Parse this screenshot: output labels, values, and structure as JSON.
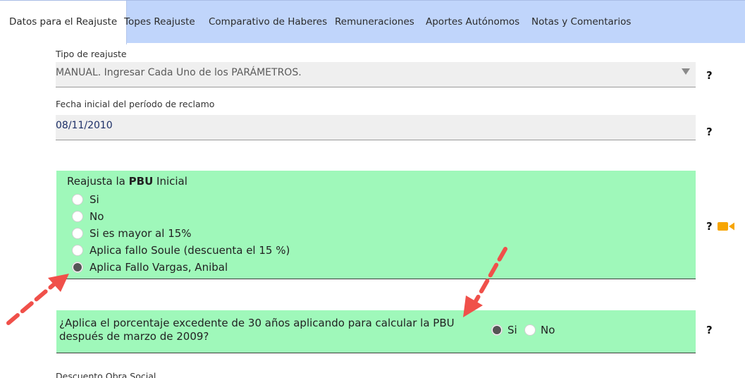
{
  "tabs": [
    {
      "label": "Datos para el Reajuste",
      "active": true
    },
    {
      "label": "Topes Reajuste",
      "active": false
    },
    {
      "label": "Comparativo de Haberes",
      "active": false
    },
    {
      "label": "Remuneraciones",
      "active": false
    },
    {
      "label": "Aportes Autónomos",
      "active": false
    },
    {
      "label": "Notas y Comentarios",
      "active": false
    }
  ],
  "tipo_reajuste": {
    "label": "Tipo de reajuste",
    "value": "MANUAL. Ingresar Cada Uno de los PARÁMETROS."
  },
  "fecha_inicial": {
    "label": "Fecha inicial del período de reclamo",
    "value": "08/11/2010"
  },
  "help_mark": "?",
  "pbu_group": {
    "title_prefix": "Reajusta la ",
    "title_bold": "PBU",
    "title_suffix": " Inicial",
    "options": [
      {
        "label": "Si",
        "selected": false
      },
      {
        "label": "No",
        "selected": false
      },
      {
        "label": "Si es mayor al 15%",
        "selected": false
      },
      {
        "label": "Aplica fallo Soule (descuenta el 15 %)",
        "selected": false
      },
      {
        "label": "Aplica Fallo Vargas, Anibal",
        "selected": true
      }
    ]
  },
  "excedente": {
    "question": "¿Aplica el porcentaje excedente de 30 años aplicando para calcular la PBU después de marzo de 2009?",
    "options": [
      {
        "label": "Si",
        "selected": true
      },
      {
        "label": "No",
        "selected": false
      }
    ]
  },
  "descuento_obra_social": {
    "label": "Descuento Obra Social"
  },
  "colors": {
    "tabbar": "#c0d5fb",
    "green_panel": "#9ff8ba",
    "video_icon": "#f7a500",
    "annotation_arrow": "#f0504a"
  },
  "icons": {
    "video": "video-camera-icon",
    "dropdown": "chevron-down-icon"
  }
}
